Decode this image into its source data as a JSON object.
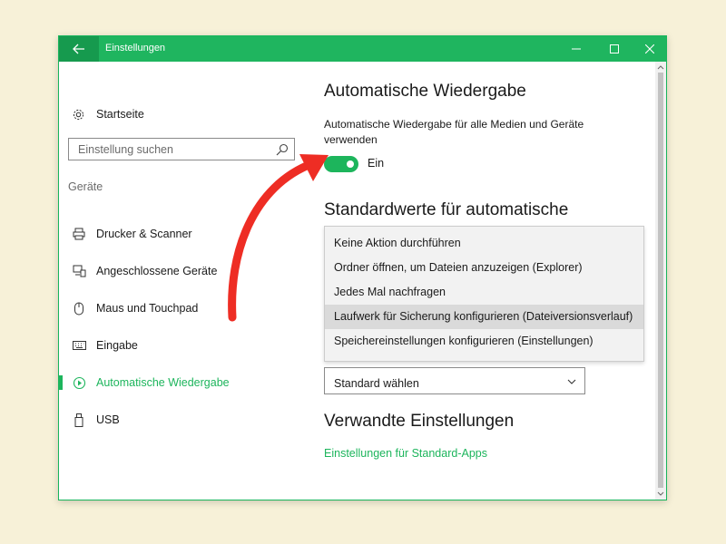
{
  "window": {
    "title": "Einstellungen"
  },
  "sidebar": {
    "home_label": "Startseite",
    "search_placeholder": "Einstellung suchen",
    "section_label": "Geräte",
    "items": [
      {
        "label": "Drucker & Scanner",
        "icon": "printer-icon"
      },
      {
        "label": "Angeschlossene Geräte",
        "icon": "devices-icon"
      },
      {
        "label": "Maus und Touchpad",
        "icon": "mouse-icon"
      },
      {
        "label": "Eingabe",
        "icon": "keyboard-icon"
      },
      {
        "label": "Automatische Wiedergabe",
        "icon": "autoplay-icon",
        "active": true
      },
      {
        "label": "USB",
        "icon": "usb-icon"
      }
    ]
  },
  "main": {
    "title": "Automatische Wiedergabe",
    "description": "Automatische Wiedergabe für alle Medien und Geräte verwenden",
    "toggle_state": "Ein",
    "defaults_heading": "Standardwerte für automatische",
    "dropdown_options": [
      "Keine Aktion durchführen",
      "Ordner öffnen, um Dateien anzuzeigen (Explorer)",
      "Jedes Mal nachfragen",
      "Laufwerk für Sicherung konfigurieren (Dateiversionsverlauf)",
      "Speichereinstellungen konfigurieren (Einstellungen)"
    ],
    "dropdown_behind_value": "Standard wählen",
    "related_heading": "Verwandte Einstellungen",
    "related_link": "Einstellungen für Standard-Apps"
  },
  "colors": {
    "accent": "#1db55c",
    "titlebar": "#1fb55f",
    "annotation_arrow": "#ee2d24",
    "background": "#f7f1d8"
  }
}
